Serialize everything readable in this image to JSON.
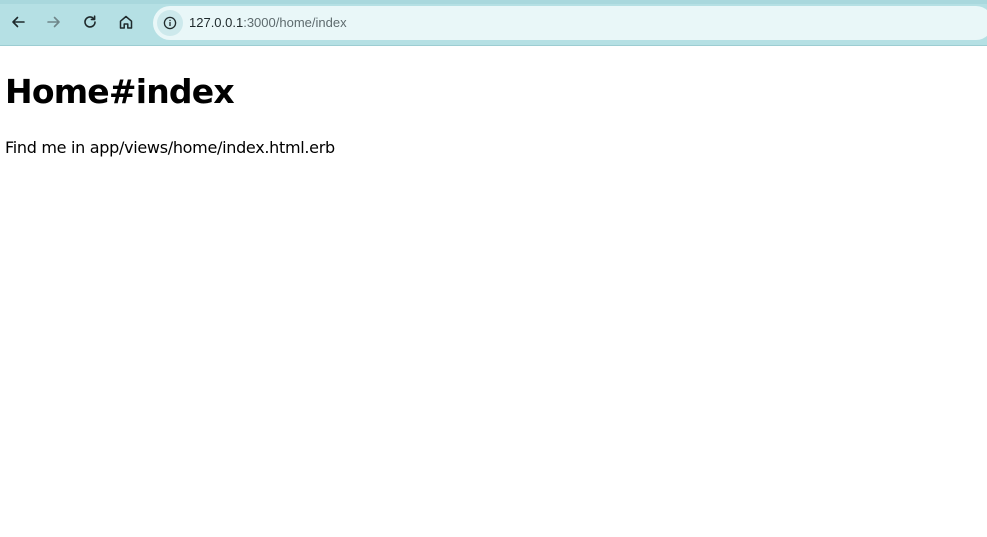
{
  "browser": {
    "url_host": "127.0.0.1",
    "url_rest": ":3000/home/index",
    "icons": {
      "back": "back-arrow-icon",
      "forward": "forward-arrow-icon",
      "reload": "reload-icon",
      "home": "home-icon",
      "site_info": "info-icon"
    },
    "colors": {
      "toolbar": "#b5e0e4",
      "omnibox": "#e9f7f8"
    }
  },
  "page": {
    "title": "Home#index",
    "text": "Find me in app/views/home/index.html.erb"
  }
}
